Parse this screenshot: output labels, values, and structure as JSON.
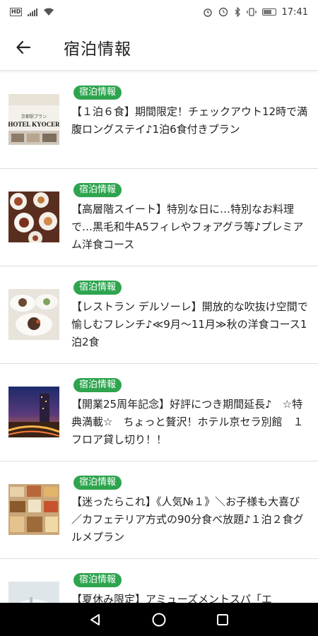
{
  "status_bar": {
    "hd_label": "HD",
    "time": "17:41",
    "battery_percent": 60
  },
  "app_bar": {
    "title": "宿泊情報",
    "back_icon": "arrow-left-icon"
  },
  "items": [
    {
      "badge": "宿泊情報",
      "title": "【１泊６食】期間限定！チェックアウト12時で満腹ロングステイ♪1泊6食付きプラン",
      "thumb_text_top": "京都駅プラン",
      "thumb_text_main": "HOTEL KYOCER"
    },
    {
      "badge": "宿泊情報",
      "title": "【高層階スイート】特別な日に…特別なお料理で…黒毛和牛A5フィレやフォアグラ等♪プレミアム洋食コース"
    },
    {
      "badge": "宿泊情報",
      "title": "【レストラン デルソーレ】開放的な吹抜け空間で愉しむフレンチ♪≪9月～11月≫秋の洋食コース1泊2食"
    },
    {
      "badge": "宿泊情報",
      "title": "【開業25周年記念】好評につき期間延長♪　☆特典満載☆　ちょっと贅沢！ホテル京セラ別館　１フロア貸し切り！！"
    },
    {
      "badge": "宿泊情報",
      "title": "【迷ったらこれ】《人気№１》＼お子様も大喜び／カフェテリア方式の90分食べ放題♪１泊２食グルメプラン"
    },
    {
      "badge": "宿泊情報",
      "title": "【夏休み限定】アミューズメントスパ「エ"
    }
  ],
  "nav_bar": {
    "back": "triangle-back-icon",
    "home": "circle-home-icon",
    "recents": "square-recents-icon"
  }
}
